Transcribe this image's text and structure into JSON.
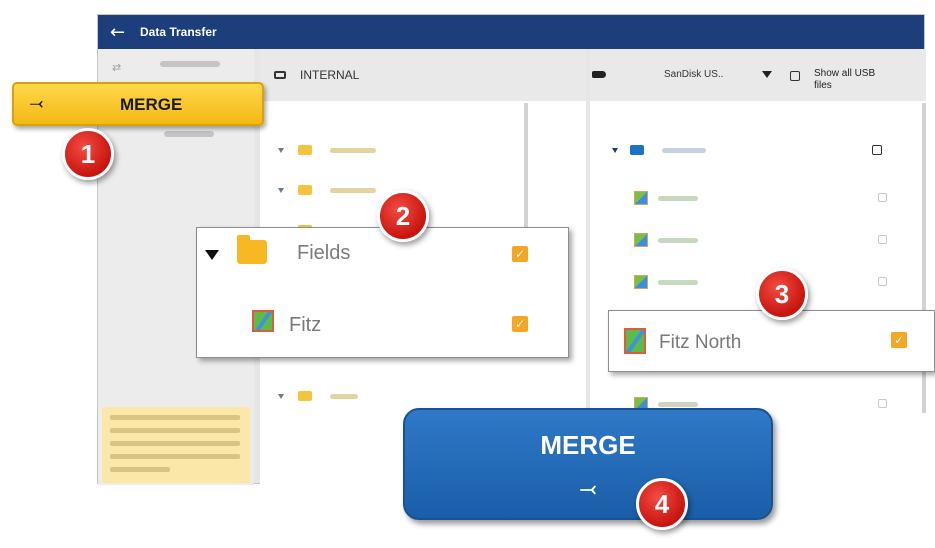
{
  "titlebar": {
    "back_icon": "←",
    "title": "Data Transfer"
  },
  "left_pane": {
    "header_label": "INTERNAL"
  },
  "right_pane": {
    "device_label": "SanDisk US..",
    "show_all_label": "Show all USB files"
  },
  "merge_side_button": {
    "icon": "⤙",
    "label": "MERGE"
  },
  "callout_fields": {
    "folder_label": "Fields",
    "field_label": "Fitz",
    "checkbox_glyph": "✓"
  },
  "callout_right": {
    "field_label": "Fitz North",
    "checkbox_glyph": "✓"
  },
  "merge_main_button": {
    "label": "MERGE",
    "icon": "⤙"
  },
  "badges": [
    "1",
    "2",
    "3",
    "4"
  ],
  "colors": {
    "titlebar": "#1c3f7c",
    "merge_side": "#f3b913",
    "merge_main": "#1a5ea8",
    "badge": "#d0160f",
    "checkbox": "#f5a623"
  }
}
